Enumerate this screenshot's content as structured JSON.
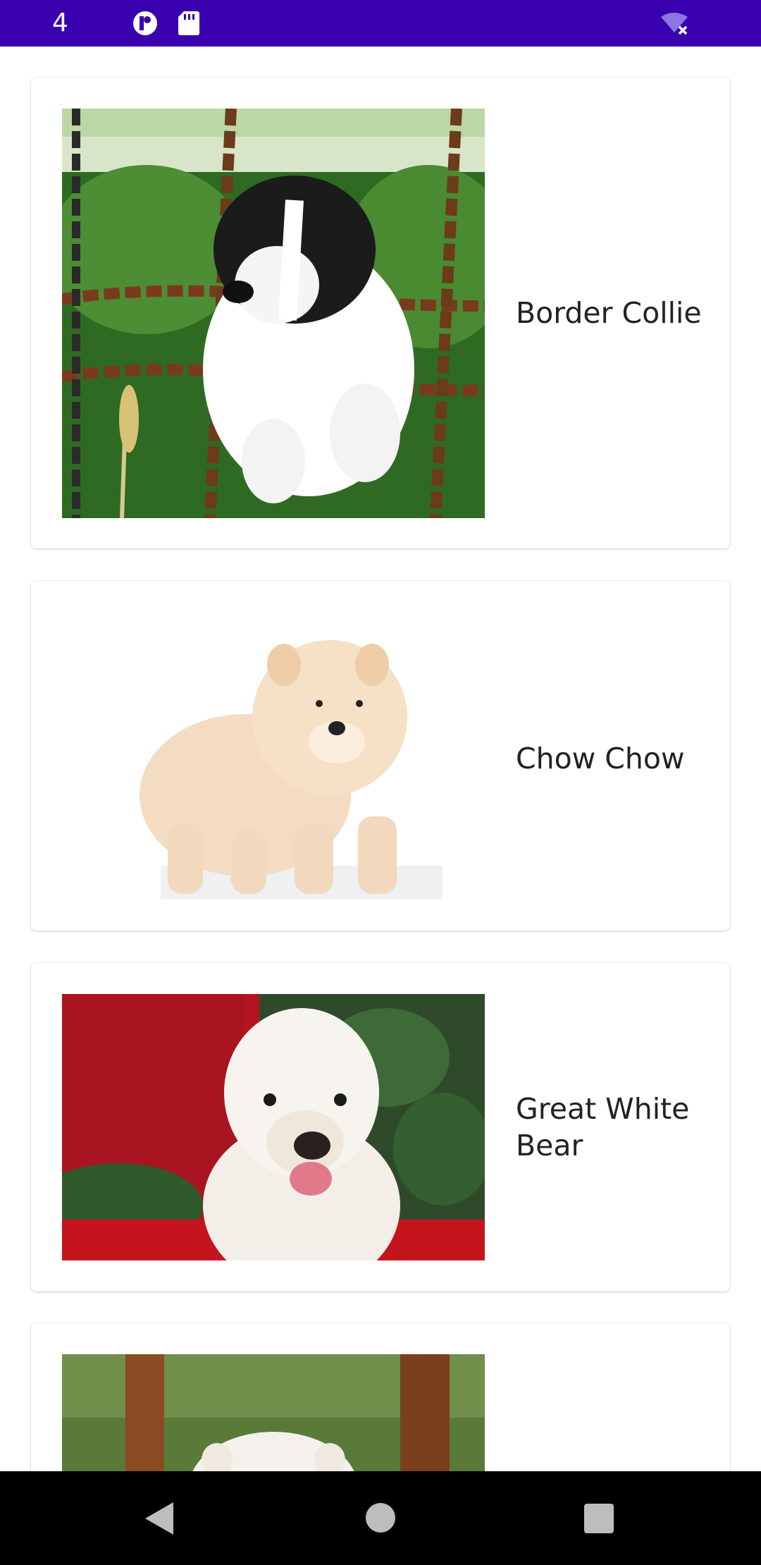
{
  "status_bar": {
    "time": "4",
    "icons": [
      "vpn-key-icon",
      "sd-card-icon",
      "wifi-off-icon"
    ],
    "color": "#3a00b0"
  },
  "breeds": [
    {
      "name": "Border Collie"
    },
    {
      "name": "Chow Chow"
    },
    {
      "name": "Great White Bear"
    },
    {
      "name": ""
    }
  ],
  "nav_bar": {
    "buttons": [
      "back-icon",
      "home-icon",
      "recents-icon"
    ]
  }
}
